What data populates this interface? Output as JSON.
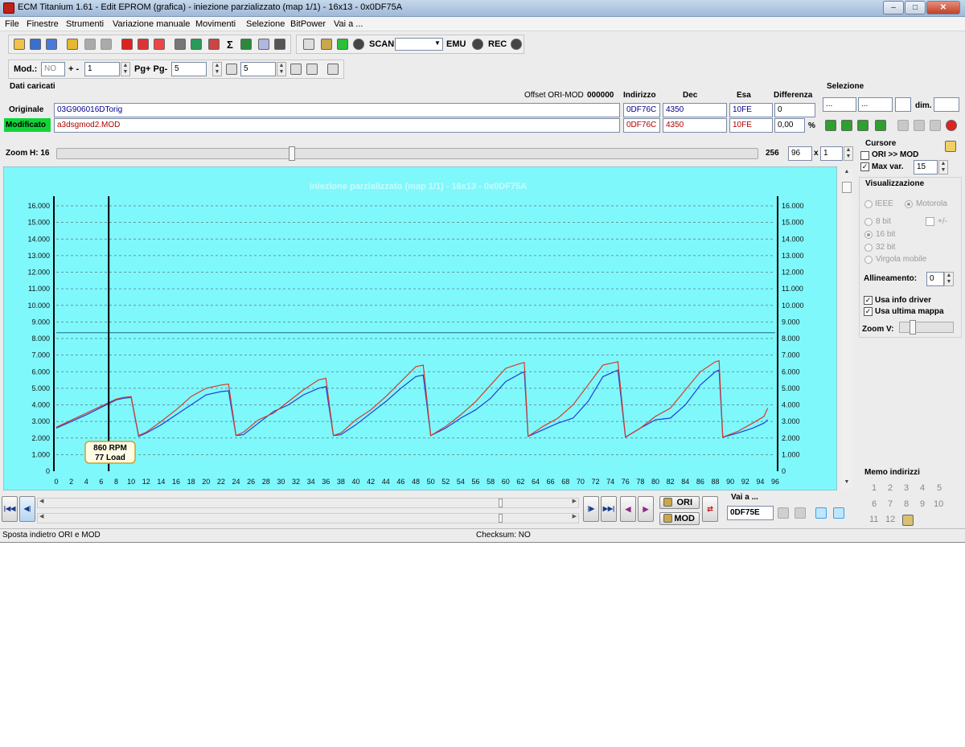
{
  "window": {
    "title": "ECM Titanium 1.61 - Edit EPROM (grafica) - iniezione parzializzato (map 1/1) - 16x13 - 0x0DF75A"
  },
  "menu": [
    "File",
    "Finestre",
    "Strumenti",
    "Variazione manuale",
    "Movimenti",
    "Selezione",
    "BitPower",
    "Vai a ..."
  ],
  "toolbar": {
    "scan_label": "SCAN",
    "emu_label": "EMU",
    "rec_label": "REC",
    "mod_label": "Mod.:",
    "mod_value": "NO",
    "plus_minus_label": "+ -",
    "step_value": "1",
    "pg_label": "Pg+ Pg-",
    "pg_value": "5",
    "p_value": "5"
  },
  "dati": {
    "heading": "Dati caricati",
    "offset_label": "Offset ORI-MOD",
    "offset_value": "000000",
    "col_indirizzo": "Indirizzo",
    "col_dec": "Dec",
    "col_esa": "Esa",
    "col_differenza": "Differenza",
    "originale_label": "Originale",
    "originale_file": "03G906016DTorig",
    "originale_addr": "0DF76C",
    "originale_dec": "4350",
    "originale_esa": "10FE",
    "originale_diff": "0",
    "modificato_label": "Modificato",
    "modificato_file": "a3dsgmod2.MOD",
    "modificato_addr": "0DF76C",
    "modificato_dec": "4350",
    "modificato_esa": "10FE",
    "modificato_diff": "0,00",
    "percent": "%"
  },
  "selezione": {
    "heading": "Selezione",
    "field1": "...",
    "field2": "...",
    "dim_label": "dim."
  },
  "zoom": {
    "label": "Zoom H: 16",
    "max": "256",
    "value": "96",
    "times": "x",
    "mult": "1"
  },
  "cursore": {
    "heading": "Cursore",
    "ori_mod_label": "ORI >> MOD",
    "max_var_label": "Max var.",
    "max_var_value": "15"
  },
  "visualizzazione": {
    "heading": "Visualizzazione",
    "ieee": "IEEE",
    "motorola": "Motorola",
    "bit8": "8 bit",
    "plusminus": "+/-",
    "bit16": "16 bit",
    "bit32": "32 bit",
    "virgola": "Virgola mobile",
    "allineamento_label": "Allineamento:",
    "allineamento_value": "0",
    "usa_info": "Usa info driver",
    "usa_ultima": "Usa ultima mappa",
    "zoom_v": "Zoom V:"
  },
  "memo": {
    "heading": "Memo indirizzi",
    "items": [
      "1",
      "2",
      "3",
      "4",
      "5",
      "6",
      "7",
      "8",
      "9",
      "10",
      "11",
      "12"
    ]
  },
  "nav": {
    "vai_label": "Vai a ...",
    "vai_value": "0DF75E",
    "ori_label": "ORI",
    "mod_label": "MOD"
  },
  "status": {
    "left": "Sposta indietro ORI e MOD",
    "center": "Checksum: NO"
  },
  "colors": {
    "plot_bg": "#7ff8fc",
    "ori_line": "#1f3fd8",
    "mod_line": "#d83a2a",
    "accent_green": "#12d43a"
  },
  "chart_data": {
    "type": "line",
    "title": "iniezione parzializzato (map 1/1) - 16x13 - 0x0DF75A",
    "xlim": [
      0,
      96
    ],
    "ylim": [
      0,
      16000
    ],
    "x_ticks": [
      0,
      2,
      4,
      6,
      8,
      10,
      12,
      14,
      16,
      18,
      20,
      22,
      24,
      26,
      28,
      30,
      32,
      34,
      36,
      38,
      40,
      42,
      44,
      46,
      48,
      50,
      52,
      54,
      56,
      58,
      60,
      62,
      64,
      66,
      68,
      70,
      72,
      74,
      76,
      78,
      80,
      82,
      84,
      86,
      88,
      90,
      92,
      94,
      96
    ],
    "y_ticks": [
      "0",
      "1.000",
      "2.000",
      "3.000",
      "4.000",
      "5.000",
      "6.000",
      "7.000",
      "8.000",
      "9.000",
      "10.000",
      "11.000",
      "12.000",
      "13.000",
      "14.000",
      "15.000",
      "16.000"
    ],
    "hline": 8350,
    "cursor_x": 7,
    "cursor_label_line1": "860 RPM",
    "cursor_label_line2": "77 Load",
    "series": [
      {
        "key": "ori",
        "points": [
          [
            0,
            2600
          ],
          [
            4,
            3400
          ],
          [
            8,
            4300
          ],
          [
            9,
            4400
          ],
          [
            10,
            4450
          ],
          [
            11,
            2100
          ],
          [
            12,
            2300
          ],
          [
            14,
            2800
          ],
          [
            16,
            3400
          ],
          [
            18,
            4000
          ],
          [
            20,
            4600
          ],
          [
            22,
            4800
          ],
          [
            23,
            4850
          ],
          [
            24,
            2150
          ],
          [
            25,
            2200
          ],
          [
            27,
            2900
          ],
          [
            29,
            3600
          ],
          [
            31,
            4000
          ],
          [
            33,
            4600
          ],
          [
            35,
            5000
          ],
          [
            36,
            5100
          ],
          [
            37,
            2150
          ],
          [
            38,
            2200
          ],
          [
            40,
            2800
          ],
          [
            42,
            3500
          ],
          [
            44,
            4200
          ],
          [
            46,
            5000
          ],
          [
            48,
            5700
          ],
          [
            49,
            5800
          ],
          [
            50,
            2150
          ],
          [
            52,
            2600
          ],
          [
            54,
            3200
          ],
          [
            56,
            3700
          ],
          [
            58,
            4400
          ],
          [
            60,
            5400
          ],
          [
            62,
            5900
          ],
          [
            62.5,
            6000
          ],
          [
            63,
            2100
          ],
          [
            65,
            2500
          ],
          [
            67,
            2900
          ],
          [
            69,
            3200
          ],
          [
            71,
            4200
          ],
          [
            73,
            5700
          ],
          [
            75,
            6100
          ],
          [
            76,
            2050
          ],
          [
            78,
            2600
          ],
          [
            80,
            3100
          ],
          [
            82,
            3200
          ],
          [
            84,
            4000
          ],
          [
            86,
            5200
          ],
          [
            88,
            6000
          ],
          [
            88.5,
            6100
          ],
          [
            89,
            2050
          ],
          [
            91,
            2300
          ],
          [
            93,
            2600
          ],
          [
            94.5,
            2900
          ],
          [
            95,
            3100
          ]
        ]
      },
      {
        "key": "mod",
        "points": [
          [
            0,
            2650
          ],
          [
            4,
            3500
          ],
          [
            8,
            4350
          ],
          [
            9,
            4450
          ],
          [
            10,
            4500
          ],
          [
            11,
            2150
          ],
          [
            12,
            2350
          ],
          [
            14,
            3000
          ],
          [
            16,
            3700
          ],
          [
            18,
            4500
          ],
          [
            20,
            5000
          ],
          [
            22,
            5200
          ],
          [
            23,
            5250
          ],
          [
            24,
            2150
          ],
          [
            25,
            2350
          ],
          [
            27,
            3100
          ],
          [
            29,
            3500
          ],
          [
            31,
            4200
          ],
          [
            33,
            4900
          ],
          [
            35,
            5500
          ],
          [
            36,
            5600
          ],
          [
            37,
            2150
          ],
          [
            38,
            2300
          ],
          [
            40,
            3100
          ],
          [
            42,
            3700
          ],
          [
            44,
            4500
          ],
          [
            46,
            5400
          ],
          [
            48,
            6300
          ],
          [
            49,
            6400
          ],
          [
            50,
            2150
          ],
          [
            52,
            2700
          ],
          [
            54,
            3400
          ],
          [
            56,
            4200
          ],
          [
            58,
            5200
          ],
          [
            60,
            6200
          ],
          [
            62,
            6500
          ],
          [
            62.5,
            6550
          ],
          [
            63,
            2100
          ],
          [
            65,
            2700
          ],
          [
            67,
            3200
          ],
          [
            69,
            4000
          ],
          [
            71,
            5200
          ],
          [
            73,
            6400
          ],
          [
            75,
            6600
          ],
          [
            76,
            2050
          ],
          [
            78,
            2600
          ],
          [
            80,
            3300
          ],
          [
            82,
            3800
          ],
          [
            84,
            4900
          ],
          [
            86,
            6000
          ],
          [
            88,
            6600
          ],
          [
            88.5,
            6650
          ],
          [
            89,
            2050
          ],
          [
            91,
            2400
          ],
          [
            93,
            2900
          ],
          [
            94.5,
            3300
          ],
          [
            95,
            3800
          ]
        ]
      }
    ]
  }
}
